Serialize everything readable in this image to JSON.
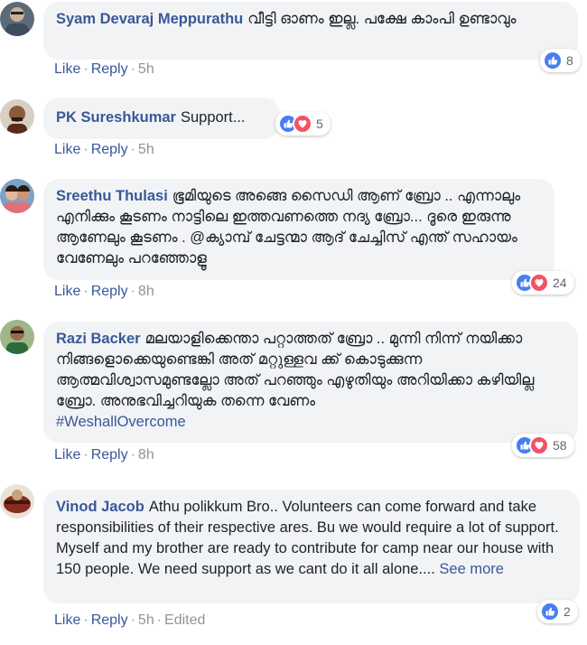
{
  "comments": [
    {
      "author": "Syam Devaraj Meppurathu",
      "text": "വീട്ടി ഓണം ഇല്ല. പക്ഷേ കാംപി ഉണ്ടാവും",
      "actions": {
        "like": "Like",
        "reply": "Reply",
        "time": "5h"
      },
      "reaction_count": "8"
    },
    {
      "author": "PK Sureshkumar",
      "text": "Support...",
      "actions": {
        "like": "Like",
        "reply": "Reply",
        "time": "5h"
      },
      "reaction_count": "5"
    },
    {
      "author": "Sreethu Thulasi",
      "text": "ഭൂമിയുടെ അങ്ങെ സൈഡി ആണ് ബ്രോ .. എന്നാലും എനിക്കും കൂടണം നാട്ടിലെ ഇത്തവണത്തെ നദ്യ ബ്രോ... ദൂരെ ഇരുന്നു ആണേലും കൂടണം . @ക്യാമ്പ് ചേട്ടന്മാ ആദ് ചേച്ചിസ് എന്ത് സഹായം വേണേലും പറഞ്ഞോളൂ",
      "actions": {
        "like": "Like",
        "reply": "Reply",
        "time": "8h"
      },
      "reaction_count": "24"
    },
    {
      "author": "Razi Backer",
      "text": "മലയാളിക്കെന്താ പറ്റാത്തത് ബ്രോ .. മുന്നി നിന്ന് നയിക്കാ നിങ്ങളൊക്കെയുണ്ടെങ്കി അത് മറ്റുള്ളവ ക്ക് കൊടുക്കുന്ന ആത്മവിശ്വാസമുണ്ടല്ലോ അത് പറഞ്ഞും എഴുതിയും അറിയിക്കാ കഴിയില്ല ബ്രോ. അനുഭവിച്ചറിയുക തന്നെ വേണം",
      "hashtag": "#WeshallOvercome",
      "actions": {
        "like": "Like",
        "reply": "Reply",
        "time": "8h"
      },
      "reaction_count": "58"
    },
    {
      "author": "Vinod Jacob",
      "text": "Athu polikkum Bro.. Volunteers can come forward and take responsibilities of their respective ares. Bu we would require a lot of support. Myself and my brother are ready to contribute for camp near our house with 150 people. We need support as we cant do it all alone....",
      "see_more": "See more",
      "actions": {
        "like": "Like",
        "reply": "Reply",
        "time": "5h",
        "edited": "Edited"
      },
      "reaction_count": "2"
    }
  ],
  "colors": {
    "link": "#385898",
    "bubble": "#f2f3f5",
    "muted": "#90949c",
    "like": "#4a7ef0",
    "love": "#f25268"
  }
}
